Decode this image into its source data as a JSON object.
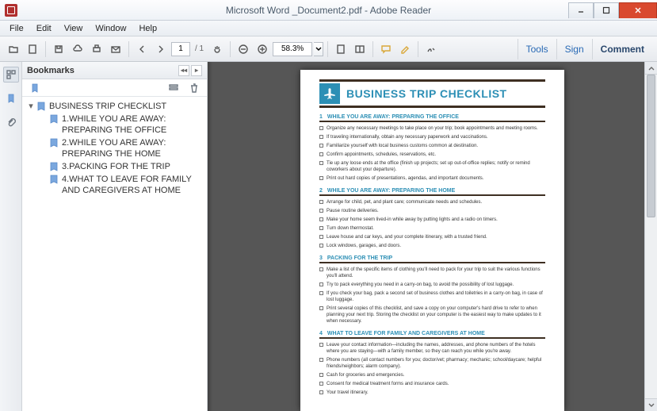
{
  "window": {
    "title": "Microsoft Word _Document2.pdf - Adobe Reader"
  },
  "menu": {
    "file": "File",
    "edit": "Edit",
    "view": "View",
    "window": "Window",
    "help": "Help"
  },
  "toolbar": {
    "page_current": "1",
    "page_total": "/ 1",
    "zoom": "58.3%",
    "tools": "Tools",
    "sign": "Sign",
    "comment": "Comment"
  },
  "bookmarks_panel": {
    "header": "Bookmarks"
  },
  "bookmarks": {
    "root": "BUSINESS TRIP CHECKLIST",
    "items": [
      "1.WHILE YOU ARE AWAY: PREPARING THE OFFICE",
      "2.WHILE YOU ARE AWAY: PREPARING THE HOME",
      "3.PACKING FOR THE TRIP",
      "4.WHAT TO LEAVE FOR FAMILY AND CAREGIVERS AT HOME"
    ]
  },
  "document": {
    "title": "BUSINESS TRIP CHECKLIST",
    "sections": [
      {
        "num": "1",
        "title": "WHILE YOU ARE AWAY: PREPARING THE OFFICE",
        "items": [
          "Organize any necessary meetings to take place on your trip; book appointments and meeting rooms.",
          "If traveling internationally, obtain any necessary paperwork and vaccinations.",
          "Familiarize yourself with local business customs common at destination.",
          "Confirm appointments, schedules, reservations, etc.",
          "Tie up any loose ends at the office (finish up projects; set up out-of-office replies; notify or remind coworkers about your departure).",
          "Print out hard copies of presentations, agendas, and important documents."
        ]
      },
      {
        "num": "2",
        "title": "WHILE YOU ARE AWAY: PREPARING THE HOME",
        "items": [
          "Arrange for child, pet, and plant care; communicate needs and schedules.",
          "Pause routine deliveries.",
          "Make your home seem lived-in while away by putting lights and a radio on timers.",
          "Turn down thermostat.",
          "Leave house and car keys, and your complete itinerary, with a trusted friend.",
          "Lock windows, garages, and doors."
        ]
      },
      {
        "num": "3",
        "title": "PACKING FOR THE TRIP",
        "items": [
          "Make a list of the specific items of clothing you'll need to pack for your trip to suit the various functions you'll attend.",
          "Try to pack everything you need in a carry-on bag, to avoid the possibility of lost luggage.",
          "If you check your bag, pack a second set of business clothes and toiletries in a carry-on bag, in case of lost luggage.",
          "Print several copies of this checklist, and save a copy on your computer's hard drive to refer to when planning your next trip. Storing the checklist on your computer is the easiest way to make updates to it when necessary."
        ]
      },
      {
        "num": "4",
        "title": "WHAT TO LEAVE FOR FAMILY AND CAREGIVERS AT HOME",
        "items": [
          "Leave your contact information—including the names, addresses, and phone numbers of the hotels where you are staying—with a family member, so they can reach you while you're away.",
          "Phone numbers (all contact numbers for you; doctor/vet; pharmacy; mechanic; school/daycare; helpful friends/neighbors; alarm company).",
          "Cash for groceries and emergencies.",
          "Consent for medical treatment forms and insurance cards.",
          "Your travel itinerary."
        ]
      }
    ]
  }
}
